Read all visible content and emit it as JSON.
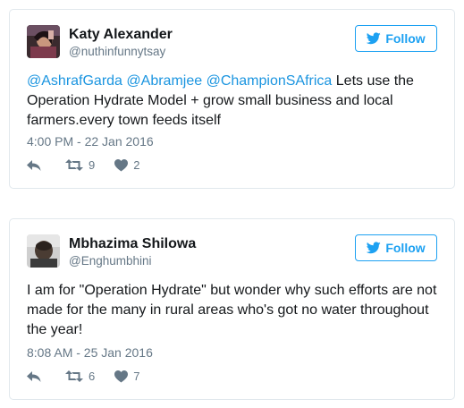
{
  "tweets": [
    {
      "name": "Katy Alexander",
      "handle": "@nuthinfunnytsay",
      "follow_label": "Follow",
      "mentions": [
        "@AshrafGarda",
        "@Abramjee",
        "@ChampionSAfrica"
      ],
      "text": "Lets use the Operation Hydrate Model + grow small business and local farmers.every town feeds itself",
      "timestamp": "4:00 PM - 22 Jan 2016",
      "retweets": "9",
      "likes": "2",
      "icons": {
        "reply": "reply-icon",
        "retweet": "retweet-icon",
        "like": "heart-icon",
        "follow": "twitter-bird-icon"
      }
    },
    {
      "name": "Mbhazima Shilowa",
      "handle": "@Enghumbhini",
      "follow_label": "Follow",
      "text": "I am for \"Operation Hydrate\" but wonder why such efforts are not made for the many in rural areas who's got no water throughout the year!",
      "timestamp": "8:08 AM - 25 Jan 2016",
      "retweets": "6",
      "likes": "7",
      "icons": {
        "reply": "reply-icon",
        "retweet": "retweet-icon",
        "like": "heart-icon",
        "follow": "twitter-bird-icon"
      }
    }
  ],
  "colors": {
    "accent": "#1da1f2",
    "mention": "#1b95e0",
    "muted": "#657786",
    "border": "#e1e8ed"
  }
}
